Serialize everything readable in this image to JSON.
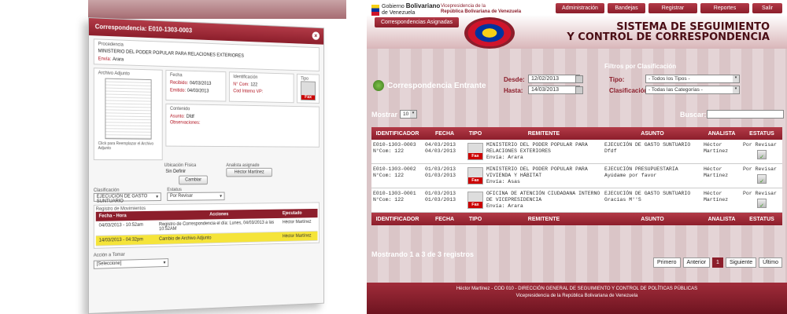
{
  "detail": {
    "title": "Correspondencia: E010-1303-0003",
    "procedencia_label": "Procedencia",
    "procedencia": "MINISTERIO DEL PODER POPULAR PARA RELACIONES EXTERIORES",
    "envia_label": "Envía:",
    "envia": "Arara",
    "archivo_label": "Archivo Adjunto",
    "archivo_hint": "Click para Reemplazar el Archivo Adjunto",
    "fecha_label": "Fecha",
    "recibido_label": "Recibido:",
    "recibido": "04/03/2013",
    "emitido_label": "Emitido:",
    "emitido": "04/03/2013",
    "identificacion_label": "Identificación",
    "ncom_label": "N° Com:",
    "ncom": "122",
    "codinterno_label": "Cod Interno VP:",
    "tipo_label": "Tipo",
    "tipo_fax": "Fax",
    "contenido_label": "Contenido",
    "asunto_label": "Asunto:",
    "asunto": "Dfdf",
    "observaciones_label": "Observaciones:",
    "ubicacion_label": "Ubicación Física",
    "ubicacion_value": "Sin Definir",
    "cambiar_label": "Cambiar",
    "analista_label": "Analista asignado",
    "analista_value": "Héctor Martínez",
    "clasificacion_label": "Clasificación",
    "clasificacion_value": "EJECUCIÓN DE GASTO SUNTUARIO",
    "estatus_label": "Estatus",
    "estatus_value": "Por Revisar",
    "registro_label": "Registro de Movimientos",
    "mov_headers": [
      "Fecha - Hora",
      "Acciones",
      "Ejecutado"
    ],
    "movimientos": [
      {
        "fecha": "04/03/2013 - 10:52am",
        "accion": "Registro de Correspondencia el día: Lunes, 04/03/2013 a las 10:52AM",
        "ejecutado": "Héctor Martínez"
      },
      {
        "fecha": "14/03/2013 - 04:32pm",
        "accion": "Cambio de Archivo Adjunto",
        "ejecutado": "Héctor Martínez"
      }
    ],
    "accion_label": "Acción a Tomar",
    "accion_value": "[Seleccione]"
  },
  "header": {
    "gob_line1": "Gobierno",
    "gob_bold": "Bolivariano",
    "gob_line2": "de Venezuela",
    "vp_line1": "Vicepresidencia de la",
    "vp_line2": "República Bolivariana de Venezuela",
    "nav": [
      "Administración",
      "Bandejas",
      "Registrar",
      "Reportes",
      "Salir"
    ],
    "tab": "Correspondencias Asignadas",
    "sys_line1": "SISTEMA DE SEGUIMIENTO",
    "sys_line2": "Y CONTROL DE CORRESPONDENCIA"
  },
  "main": {
    "section_title": "Correspondencia Entrante",
    "desde_label": "Desde:",
    "desde": "12/02/2013",
    "hasta_label": "Hasta:",
    "hasta": "14/03/2013",
    "filtros_title": "Filtros por Clasificación",
    "tipo_label": "Tipo:",
    "tipo_value": "- Todos los Tipos -",
    "clasificacion_label": "Clasificación:",
    "clasificacion_value": "- Todas las Categorías -",
    "mostrar_label": "Mostrar",
    "mostrar_value": "10",
    "buscar_label": "Buscar:",
    "columns": [
      "IDENTIFICADOR",
      "FECHA",
      "TIPO",
      "REMITENTE",
      "ASUNTO",
      "ANALISTA",
      "ESTATUS"
    ],
    "rows": [
      {
        "id": "E010-1303-0003",
        "ncom": "N°Com: 122",
        "fecha1": "04/03/2013",
        "fecha2": "04/03/2013",
        "tipo": "Fax",
        "remitente": "MINISTERIO DEL PODER POPULAR PARA RELACIONES EXTERIORES",
        "envia": "Envía: Arara",
        "asunto1": "EJECUCIÓN DE GASTO SUNTUARIO",
        "asunto2": "Dfdf",
        "analista": "Héctor Martínez",
        "estatus": "Por Revisar"
      },
      {
        "id": "E010-1303-0002",
        "ncom": "N°Com: 122",
        "fecha1": "01/03/2013",
        "fecha2": "01/03/2013",
        "tipo": "Fax",
        "remitente": "MINISTERIO DEL PODER POPULAR PARA VIVIENDA Y HÁBITAT",
        "envia": "Envía: Asas",
        "asunto1": "EJECUCIÓN PRESUPUESTARIA",
        "asunto2": "Ayúdame por favor",
        "analista": "Héctor Martínez",
        "estatus": "Por Revisar"
      },
      {
        "id": "E010-1303-0001",
        "ncom": "N°Com: 122",
        "fecha1": "01/03/2013",
        "fecha2": "01/03/2013",
        "tipo": "Fax",
        "remitente": "OFICINA DE ATENCIÓN CIUDADANA INTERNO DE VICEPRESIDENCIA",
        "envia": "Envía: Arara",
        "asunto1": "EJECUCIÓN DE GASTO SUNTUARIO",
        "asunto2": "Gracias M''S",
        "analista": "Héctor Martínez",
        "estatus": "Por Revisar"
      }
    ],
    "showing": "Mostrando 1 a 3 de 3 registros",
    "pager": [
      "Primero",
      "Anterior",
      "1",
      "Siguiente",
      "Último"
    ]
  },
  "footer": {
    "line1": "Héctor Martínez - COD 010 - DIRECCIÓN GENERAL DE SEGUIMIENTO Y CONTROL DE POLÍTICAS PÚBLICAS",
    "line2": "Vicepresidencia de la República Bolivariana de Venezuela"
  },
  "colors": {
    "brand": "#8c1e2b",
    "accent": "#b23a47",
    "highlight": "#f5e43a"
  }
}
